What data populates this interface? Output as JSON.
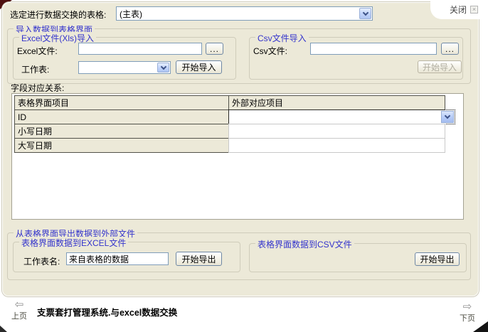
{
  "window": {
    "close_label": "关闭"
  },
  "header": {
    "table_select_label": "选定进行数据交换的表格:",
    "table_select_value": "(主表)"
  },
  "import_section": {
    "title": "导入数据到表格界面",
    "excel_group": {
      "title": "Excel文件(Xls)导入",
      "file_label": "Excel文件:",
      "file_value": "",
      "browse_label": "...",
      "sheet_label": "工作表:",
      "sheet_value": "",
      "start_button": "开始导入"
    },
    "csv_group": {
      "title": "Csv文件导入",
      "file_label": "Csv文件:",
      "file_value": "",
      "browse_label": "...",
      "start_button": "开始导入"
    }
  },
  "mapping_section": {
    "title": "字段对应关系:",
    "table": {
      "columns": [
        "表格界面项目",
        "外部对应项目"
      ],
      "rows": [
        {
          "field": "ID",
          "mapped": ""
        },
        {
          "field": "小写日期",
          "mapped": ""
        },
        {
          "field": "大写日期",
          "mapped": ""
        }
      ]
    }
  },
  "export_section": {
    "title": "从表格界面导出数据到外部文件",
    "excel_group": {
      "title": "表格界面数据到EXCEL文件",
      "sheet_name_label": "工作表名:",
      "sheet_name_value": "来自表格的数据",
      "start_button": "开始导出"
    },
    "csv_group": {
      "title": "表格界面数据到CSV文件",
      "start_button": "开始导出"
    }
  },
  "footer": {
    "status_text": "支票套打管理系统.与excel数据交换",
    "prev_label": "上页",
    "next_label": "下页"
  },
  "icons": {
    "close": "×",
    "prev_arrow": "⇦",
    "next_arrow": "⇨"
  },
  "colors": {
    "panel_bg": "#ece9d8",
    "accent_blue": "#3333cc",
    "corner_maroon": "#4e0f0f",
    "input_border": "#7f9db9"
  }
}
